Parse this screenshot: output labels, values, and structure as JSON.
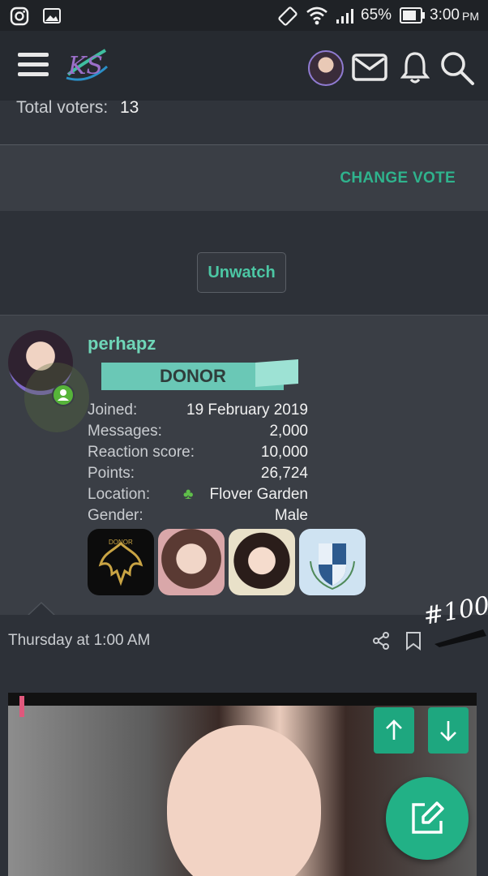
{
  "status_bar": {
    "battery": "65%",
    "time": "3:00",
    "ampm": "PM"
  },
  "header": {
    "logo_text": "KS"
  },
  "poll": {
    "total_voters_label": "Total voters:",
    "total_voters": "13",
    "change_vote_label": "CHANGE VOTE"
  },
  "watch": {
    "unwatch_label": "Unwatch"
  },
  "user": {
    "username": "perhapz",
    "banner": "DONOR",
    "stats": [
      {
        "label": "Joined:",
        "value": "19 February 2019"
      },
      {
        "label": "Messages:",
        "value": "2,000"
      },
      {
        "label": "Reaction score:",
        "value": "10,000"
      },
      {
        "label": "Points:",
        "value": "26,724"
      },
      {
        "label": "Location:",
        "value": "Flover Garden"
      },
      {
        "label": "Gender:",
        "value": "Male"
      }
    ],
    "trophy_1_text": "DONOR"
  },
  "post": {
    "timestamp": "Thursday at 1:00 AM",
    "handwritten_number": "#100"
  },
  "colors": {
    "accent": "#4cc7a4",
    "button_green": "#1ea77f"
  }
}
